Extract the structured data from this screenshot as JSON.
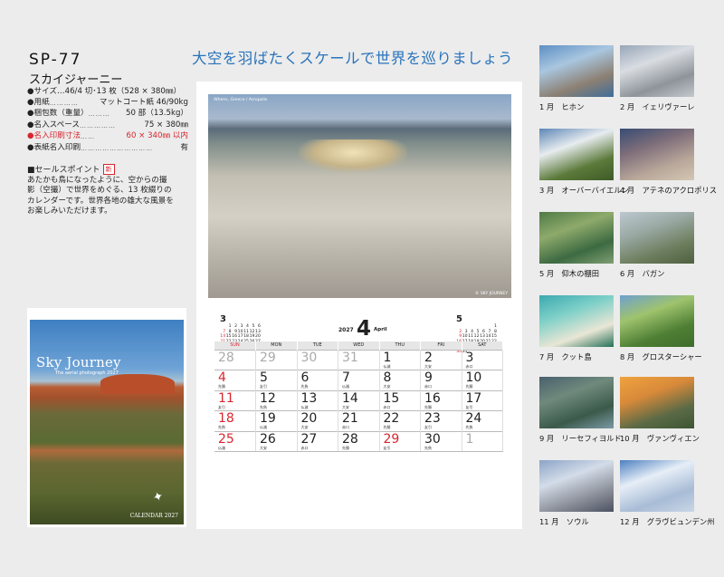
{
  "product": {
    "code": "SP-77",
    "name": "スカイジャーニー"
  },
  "specs": [
    {
      "label": "●サイズ…46/4 切･13 枚（528 × 380㎜）",
      "dots": "",
      "value": ""
    },
    {
      "label": "●用紙",
      "dots": "………… ",
      "value": "マットコート紙 46/90kg"
    },
    {
      "label": "●梱包数（重量）",
      "dots": "………",
      "value": "50 部（13.5kg）"
    },
    {
      "label": "●名入スペース",
      "dots": "……………",
      "value": "75 × 380㎜"
    },
    {
      "label": "●名入印刷寸法",
      "dots": "……",
      "value": "60 × 340㎜ 以内"
    },
    {
      "label": "●表紙名入印刷",
      "dots": "…………………………",
      "value": "有"
    }
  ],
  "sales_point": {
    "heading": "■セールスポイント",
    "badge": "新",
    "lines": [
      "あたかも鳥になったように、空からの撮",
      "影（空撮）で世界をめぐる、13 枚綴りの",
      "カレンダーです。世界各地の雄大な風景を",
      "お楽しみいただけます。"
    ]
  },
  "cover": {
    "title": "Sky Journey",
    "subtitle": "The aerial photograph 2027",
    "calendar_label": "CALENDAR 2027"
  },
  "headline": "大空を羽ばたくスケールで世界を巡りましょう",
  "calendar": {
    "photo_caption": "Athens, Greece / Acropolis",
    "photo_credit": "© SKY JOURNEY",
    "year": "2027",
    "month": "4",
    "month_en": "April",
    "weekdays": [
      "SUN",
      "MON",
      "TUE",
      "WED",
      "THU",
      "FRI",
      "SAT"
    ],
    "weeks": [
      [
        {
          "d": "28",
          "o": true
        },
        {
          "d": "29",
          "o": true
        },
        {
          "d": "30",
          "o": true
        },
        {
          "d": "31",
          "o": true
        },
        {
          "d": "1",
          "r": "仏滅"
        },
        {
          "d": "2",
          "r": "大安"
        },
        {
          "d": "3",
          "r": "赤口"
        }
      ],
      [
        {
          "d": "4",
          "r": "先勝"
        },
        {
          "d": "5",
          "r": "友引"
        },
        {
          "d": "6",
          "r": "先負"
        },
        {
          "d": "7",
          "r": "仏滅"
        },
        {
          "d": "8",
          "r": "大安"
        },
        {
          "d": "9",
          "r": "赤口"
        },
        {
          "d": "10",
          "r": "先勝"
        }
      ],
      [
        {
          "d": "11",
          "r": "友引"
        },
        {
          "d": "12",
          "r": "先負"
        },
        {
          "d": "13",
          "r": "仏滅"
        },
        {
          "d": "14",
          "r": "大安"
        },
        {
          "d": "15",
          "r": "赤口"
        },
        {
          "d": "16",
          "r": "先勝"
        },
        {
          "d": "17",
          "r": "友引"
        }
      ],
      [
        {
          "d": "18",
          "r": "先負"
        },
        {
          "d": "19",
          "r": "仏滅"
        },
        {
          "d": "20",
          "r": "大安"
        },
        {
          "d": "21",
          "r": "赤口"
        },
        {
          "d": "22",
          "r": "先勝"
        },
        {
          "d": "23",
          "r": "友引"
        },
        {
          "d": "24",
          "r": "先負"
        }
      ],
      [
        {
          "d": "25",
          "r": "仏滅"
        },
        {
          "d": "26",
          "r": "大安"
        },
        {
          "d": "27",
          "r": "赤口"
        },
        {
          "d": "28",
          "r": "先勝"
        },
        {
          "d": "29",
          "r": "友引",
          "h": true
        },
        {
          "d": "30",
          "r": "先負"
        },
        {
          "d": "1",
          "o": true
        }
      ]
    ],
    "mini_prev": {
      "month": "3",
      "rows": [
        [
          "",
          "1",
          "2",
          "3",
          "4",
          "5",
          "6"
        ],
        [
          "7",
          "8",
          "9",
          "10",
          "11",
          "12",
          "13"
        ],
        [
          "14",
          "15",
          "16",
          "17",
          "18",
          "19",
          "20"
        ],
        [
          "21",
          "22",
          "23",
          "24",
          "25",
          "26",
          "27"
        ],
        [
          "28",
          "29",
          "30",
          "31",
          "",
          "",
          ""
        ]
      ]
    },
    "mini_next": {
      "month": "5",
      "rows": [
        [
          "",
          "",
          "",
          "",
          "",
          "",
          "1"
        ],
        [
          "2",
          "3",
          "4",
          "5",
          "6",
          "7",
          "8"
        ],
        [
          "9",
          "10",
          "11",
          "12",
          "13",
          "14",
          "15"
        ],
        [
          "16",
          "17",
          "18",
          "19",
          "20",
          "21",
          "22"
        ],
        [
          "23",
          "24",
          "25",
          "26",
          "27",
          "28",
          "29"
        ],
        [
          "30",
          "31",
          "",
          "",
          "",
          "",
          ""
        ]
      ]
    }
  },
  "months": [
    {
      "label": "1 月　ヒホン",
      "colors": [
        "#5d8fc4",
        "#a9c6df",
        "#8c8073",
        "#3f6d9a"
      ]
    },
    {
      "label": "2 月　イェリヴァーレ",
      "colors": [
        "#97a6b8",
        "#d9dde2",
        "#8e949a",
        "#c4c9ce"
      ]
    },
    {
      "label": "3 月　オーバーバイエルン",
      "colors": [
        "#5d86b6",
        "#e7ecef",
        "#5c7a3a",
        "#3d5a27"
      ]
    },
    {
      "label": "4 月　アテネのアクロポリス",
      "colors": [
        "#384b73",
        "#7e6e7a",
        "#b9a79a",
        "#d3c7b4"
      ]
    },
    {
      "label": "5 月　仰木の棚田",
      "colors": [
        "#4f7a46",
        "#8eaa6b",
        "#3d6a42",
        "#7f9e72"
      ]
    },
    {
      "label": "6 月　バガン",
      "colors": [
        "#bcc8cf",
        "#9aa9a4",
        "#6d7e5e",
        "#4f6040"
      ]
    },
    {
      "label": "7 月　クット島",
      "colors": [
        "#3ba9b0",
        "#7fd0c8",
        "#e9e6d5",
        "#246f56"
      ]
    },
    {
      "label": "8 月　グロスターシャー",
      "colors": [
        "#6fa0cf",
        "#9fc36d",
        "#4e7f34",
        "#3e6d2c"
      ]
    },
    {
      "label": "9 月　リーセフィヨルド",
      "colors": [
        "#49606e",
        "#6f8a7c",
        "#3b5a4a",
        "#7c9aa6"
      ]
    },
    {
      "label": "10 月　ヴァンヴィエン",
      "colors": [
        "#f0a23e",
        "#d98a3a",
        "#5b6a46",
        "#3d5533"
      ]
    },
    {
      "label": "11 月　ソウル",
      "colors": [
        "#8ca4c8",
        "#d3dce8",
        "#8b8f99",
        "#4b5160"
      ]
    },
    {
      "label": "12 月　グラヴビュンデン州",
      "colors": [
        "#4d7fc0",
        "#e6eef7",
        "#a8bcd6",
        "#c9d6e6"
      ]
    }
  ]
}
